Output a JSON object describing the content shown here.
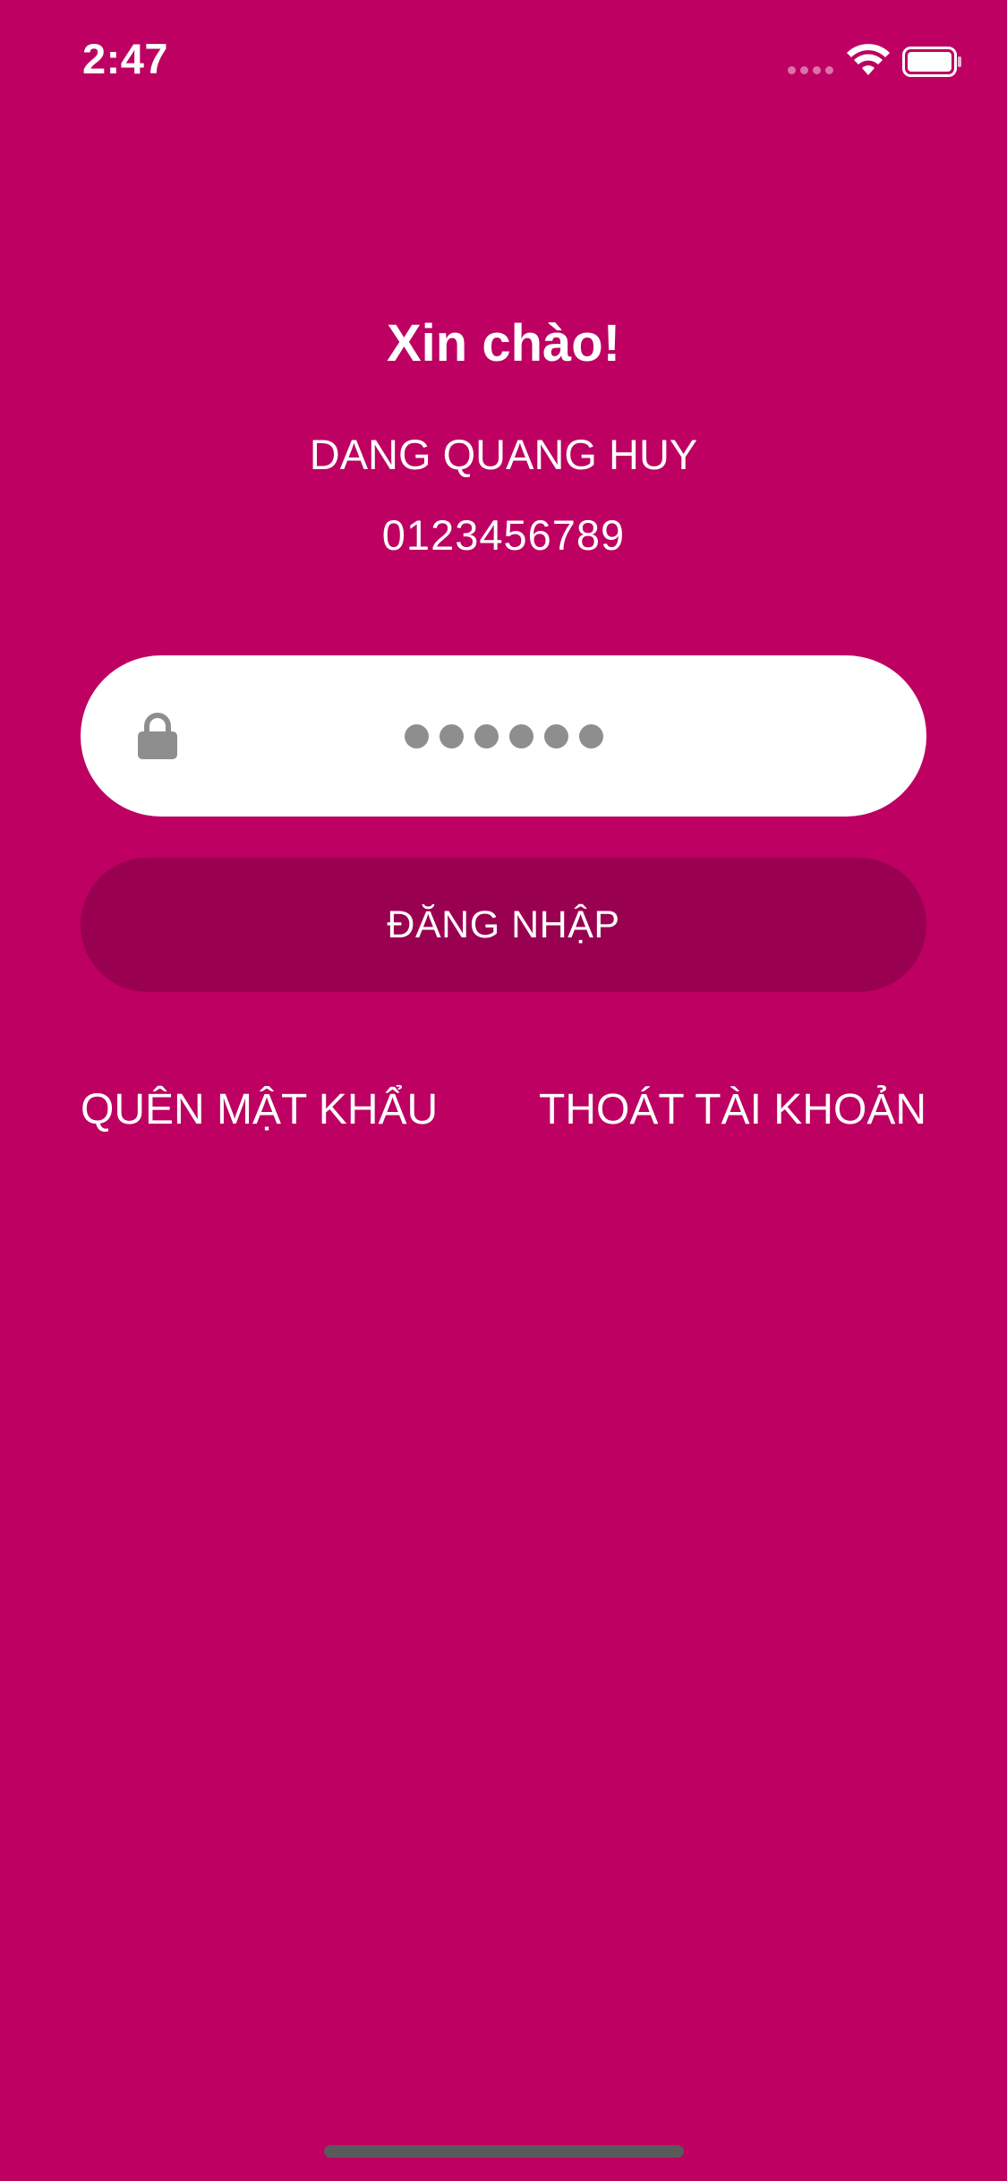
{
  "status_bar": {
    "time": "2:47",
    "icons": [
      "signal-icon",
      "wifi-icon",
      "battery-icon"
    ]
  },
  "login": {
    "greeting": "Xin chào!",
    "user_name": "DANG QUANG HUY",
    "phone": "0123456789",
    "password_field": {
      "masked_length": 6,
      "icon": "lock-icon"
    },
    "login_button": "ĐĂNG NHẬP",
    "forgot_password": "QUÊN MẬT KHẨU",
    "logout": "THOÁT TÀI KHOẢN"
  },
  "colors": {
    "background": "#BD0062",
    "button_background": "#990050",
    "field_background": "#FFFFFF",
    "text": "#FFFFFF",
    "icon_gray": "#8E8E8E"
  }
}
